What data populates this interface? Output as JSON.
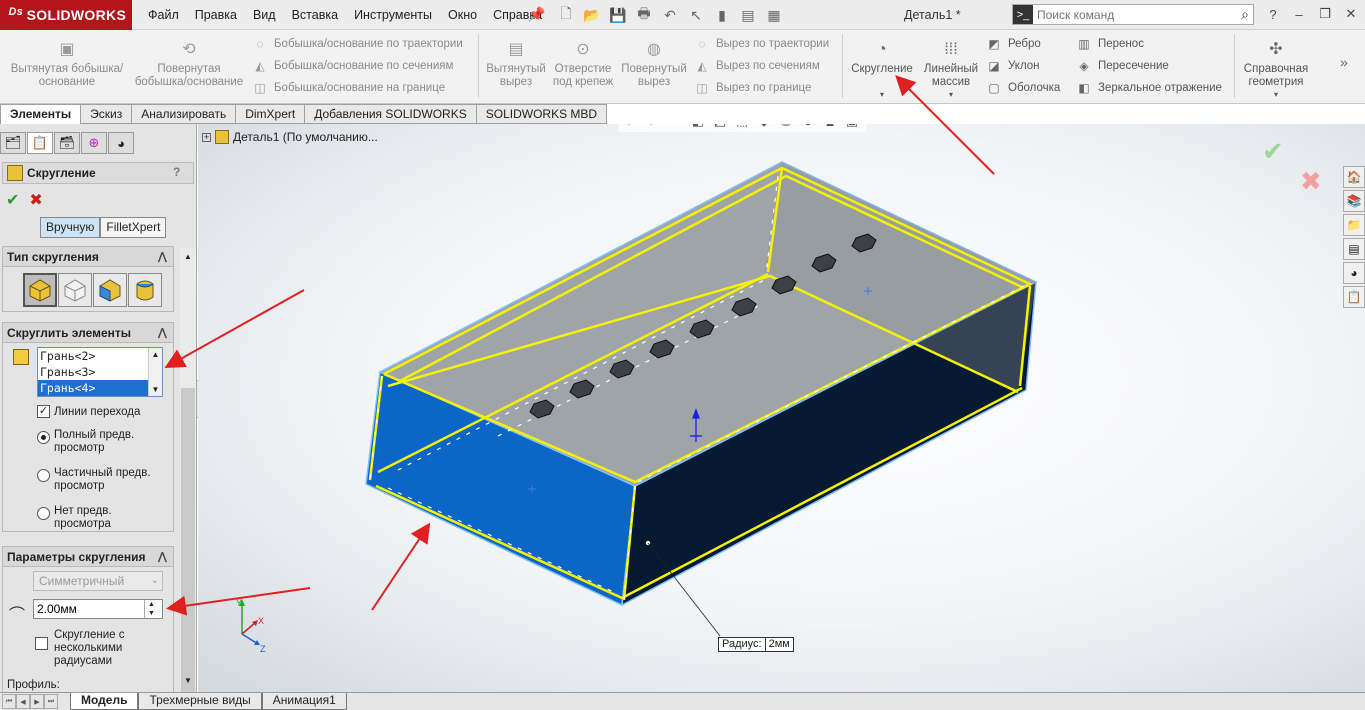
{
  "app": {
    "brand": "SOLIDWORKS",
    "document_title": "Деталь1 *"
  },
  "menu": [
    "Файл",
    "Правка",
    "Вид",
    "Вставка",
    "Инструменты",
    "Окно",
    "Справка"
  ],
  "search": {
    "placeholder": "Поиск команд"
  },
  "ribbon": {
    "extruded_boss": "Вытянутая бобышка/основание",
    "revolved_boss": "Повернутая бобышка/основание",
    "swept_boss": "Бобышка/основание по траектории",
    "lofted_boss": "Бобышка/основание по сечениям",
    "boundary_boss": "Бобышка/основание на границе",
    "extruded_cut": "Вытянутый вырез",
    "hole_wizard": "Отверстие под крепеж",
    "revolved_cut": "Повернутый вырез",
    "swept_cut": "Вырез по траектории",
    "lofted_cut": "Вырез по сечениям",
    "boundary_cut": "Вырез по границе",
    "fillet": "Скругление",
    "linear_pattern": "Линейный массив",
    "rib": "Ребро",
    "draft": "Уклон",
    "shell": "Оболочка",
    "wrap": "Перенос",
    "intersect": "Пересечение",
    "mirror": "Зеркальное отражение",
    "ref_geometry": "Справочная геометрия"
  },
  "cm_tabs": [
    "Элементы",
    "Эскиз",
    "Анализировать",
    "DimXpert",
    "Добавления SOLIDWORKS",
    "SOLIDWORKS MBD"
  ],
  "property_manager": {
    "title": "Скругление",
    "help": "?",
    "mode_manual": "Вручную",
    "mode_filletxpert": "FilletXpert",
    "group_type": "Тип скругления",
    "group_items": "Скруглить элементы",
    "items": [
      "Грань<2>",
      "Грань<3>",
      "Грань<4>"
    ],
    "tangent_propagation": "Линии перехода",
    "tangent_checked": true,
    "preview_full": "Полный предв. просмотр",
    "preview_partial": "Частичный предв. просмотр",
    "preview_none": "Нет предв. просмотра",
    "group_params": "Параметры скругления",
    "symmetric": "Симметричный",
    "radius": "2.00мм",
    "multi_radius": "Скругление с несколькими радиусами",
    "profile": "Профиль:"
  },
  "viewport": {
    "tree_item": "Деталь1  (По умолчанию...",
    "callout_label": "Радиус:",
    "callout_value": "2мм"
  },
  "bottom_tabs": [
    "Модель",
    "Трехмерные виды",
    "Анимация1"
  ],
  "colors": {
    "brand": "#b4151d",
    "selection": "#1e6fd1",
    "highlight": "#f0f000",
    "annotation": "#e02020"
  }
}
